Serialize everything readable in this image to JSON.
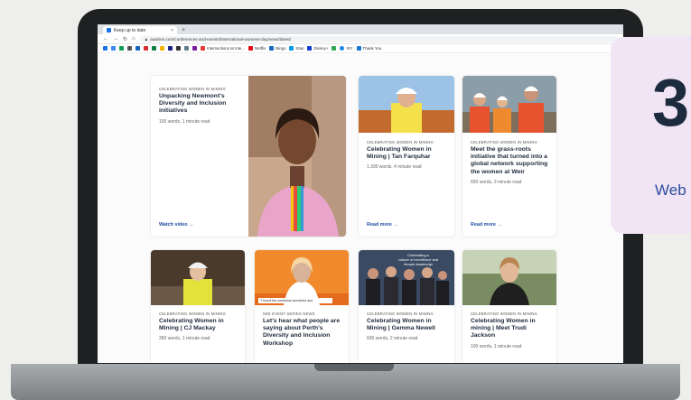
{
  "browser": {
    "tab_title": "Keep up to date",
    "new_tab_symbol": "+",
    "close_symbol": "×",
    "url": "ausimm.com/conferences-and-events/international-womens-day/news/latest/",
    "bookmarks": [
      "Intersections at Inte...",
      "Netflix",
      "Bingo",
      "Stan",
      "Disney+",
      "ISY",
      "Thank You"
    ]
  },
  "cards": [
    {
      "category": "CELEBRATING WOMEN IN MINING",
      "title": "Unpacking Newmont's Diversity and Inclusion initiatives",
      "meta": "100 words, 1 minute read",
      "link": "Watch video →"
    },
    {
      "category": "CELEBRATING WOMEN IN MINING",
      "title": "Celebrating Women in Mining | Tan Farquhar",
      "meta": "1,390 words, 4 minute read",
      "link": "Read more →"
    },
    {
      "category": "CELEBRATING WOMEN IN MINING",
      "title": "Meet the grass-roots initiative that turned into a global network supporting the women at Weir",
      "meta": "650 words, 3 minute read",
      "link": "Read more →"
    },
    {
      "category": "CELEBRATING WOMEN IN MINING",
      "title": "Celebrating Women in Mining | CJ Mackay",
      "meta": "350 words, 1 minute read"
    },
    {
      "category": "IWD EVENT SERIES NEWS",
      "title": "Let's hear what people are saying about Perth's Diversity and Inclusion Workshop",
      "meta": "",
      "image_caption": "\"I found the workshop wonderful and"
    },
    {
      "category": "CELEBRATING WOMEN IN MINING",
      "title": "Celebrating Women in Mining | Gemma Newell",
      "meta": "600 words, 2 minute read",
      "image_text": [
        "Celebrating a",
        "culture of excellence and",
        "female leadership"
      ]
    },
    {
      "category": "CELEBRATING WOMEN IN MINING",
      "title": "Celebrating Women in mining | Meet Trudi Jackson",
      "meta": "100 words, 1 minute read"
    }
  ],
  "badge": {
    "number": "3",
    "label": "Web"
  }
}
